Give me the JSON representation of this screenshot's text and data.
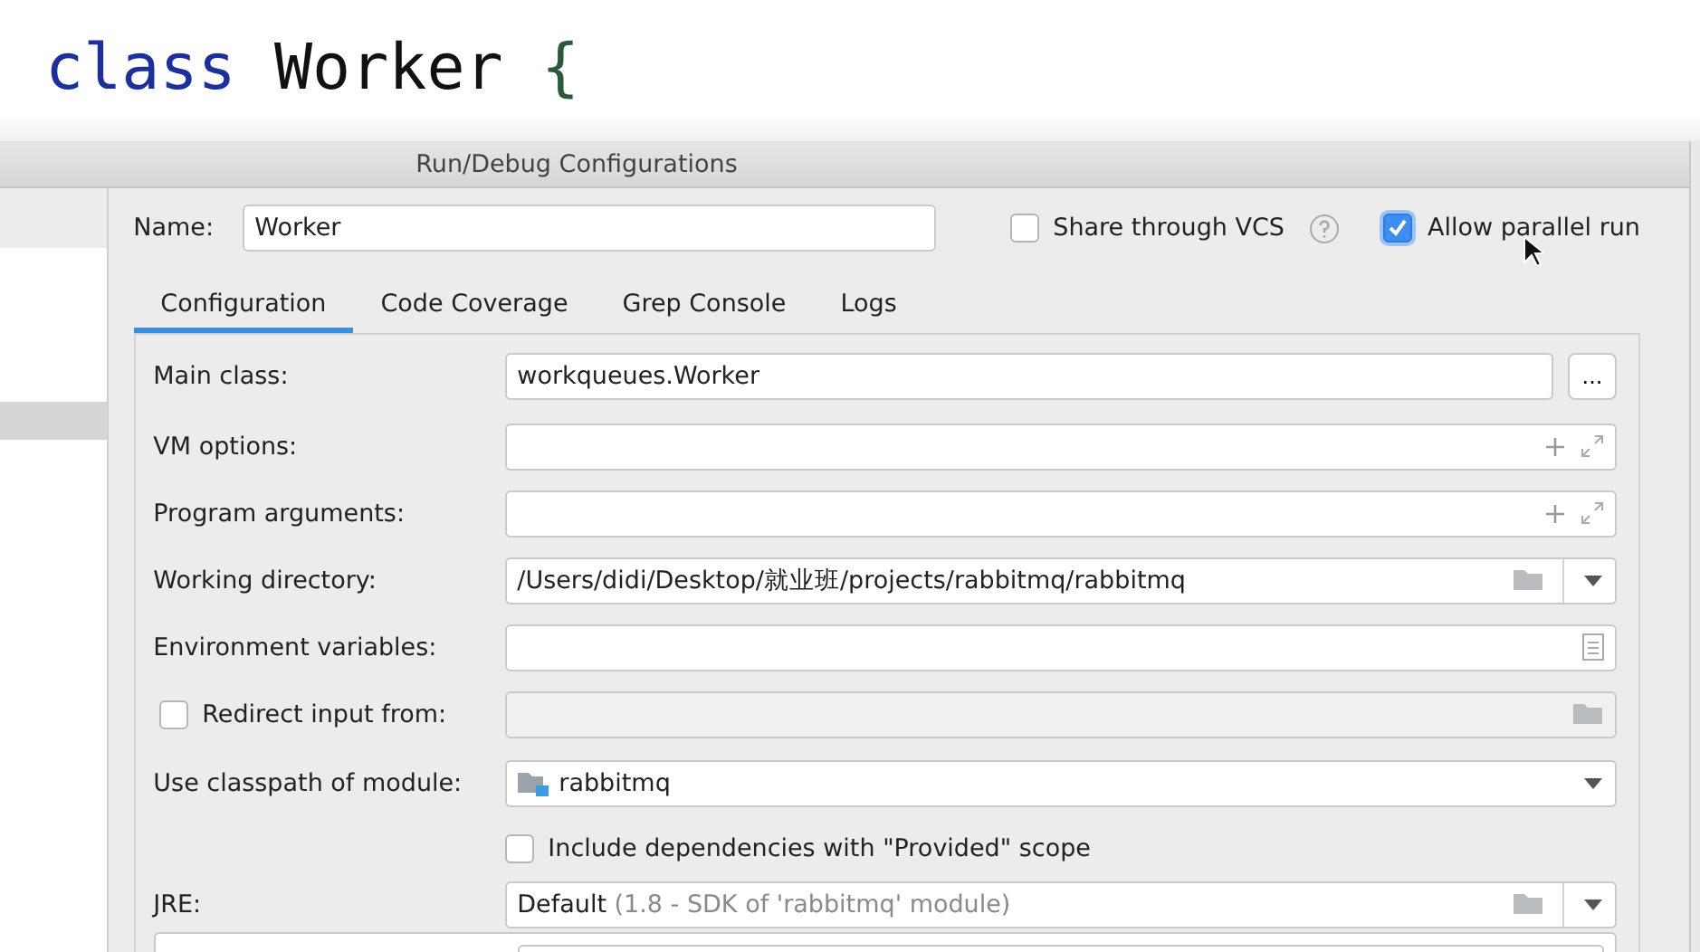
{
  "editor": {
    "code": [
      {
        "text": "class",
        "kind": "keyword"
      },
      {
        "text": "Worker",
        "kind": "name"
      },
      {
        "text": "{",
        "kind": "brace"
      }
    ]
  },
  "dialog": {
    "title": "Run/Debug Configurations",
    "name_label": "Name:",
    "name_value": "Worker",
    "options": [
      {
        "label": "Share through VCS",
        "checked": false,
        "help": true
      },
      {
        "label": "Allow parallel run",
        "checked": true,
        "help": false
      }
    ],
    "tabs": [
      {
        "label": "Configuration",
        "selected": true
      },
      {
        "label": "Code Coverage",
        "selected": false
      },
      {
        "label": "Grep Console",
        "selected": false
      },
      {
        "label": "Logs",
        "selected": false
      }
    ],
    "rows": [
      {
        "kind": "text",
        "label": "Main class:",
        "value": "workqueues.Worker",
        "button": "..."
      },
      {
        "kind": "expand",
        "label": "VM options:"
      },
      {
        "kind": "expand",
        "label": "Program arguments:"
      },
      {
        "kind": "path",
        "label": "Working directory:",
        "value": "/Users/didi/Desktop/就业班/projects/rabbitmq/rabbitmq"
      },
      {
        "kind": "env",
        "label": "Environment variables:"
      },
      {
        "kind": "redirect",
        "label": "Redirect input from:",
        "checked": false
      },
      {
        "kind": "module",
        "label": "Use classpath of module:",
        "value": "rabbitmq"
      },
      {
        "kind": "checkbox",
        "label": "Include dependencies with \"Provided\" scope",
        "checked": false
      },
      {
        "kind": "jre",
        "label": "JRE:",
        "value": "Default",
        "hint": "(1.8 - SDK of 'rabbitmq' module)"
      },
      {
        "kind": "field"
      }
    ]
  }
}
